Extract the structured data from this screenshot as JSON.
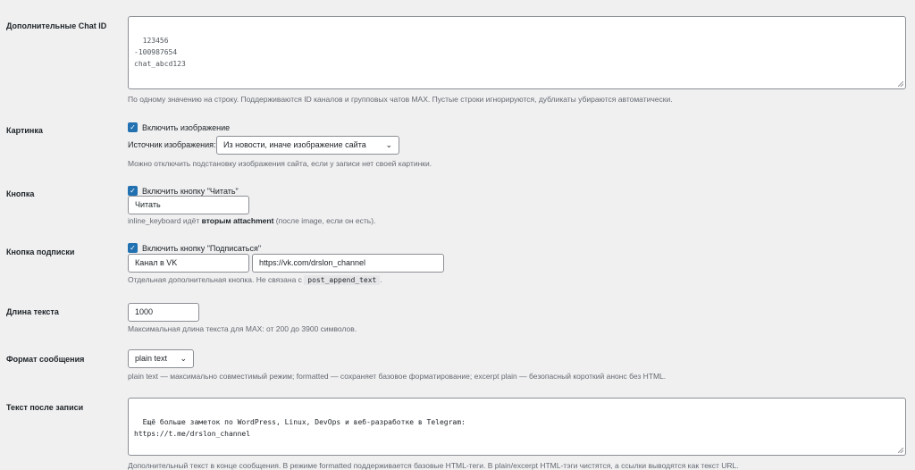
{
  "chat_ids": {
    "label": "Дополнительные Chat ID",
    "value": "123456\n-100987654\nchat_abcd123",
    "desc": "По одному значению на строку. Поддерживаются ID каналов и групповых чатов MAX. Пустые строки игнорируются, дубликаты убираются автоматически."
  },
  "image": {
    "label": "Картинка",
    "checkbox_label": "Включить изображение",
    "source_label": "Источник изображения:",
    "source_value": "Из новости, иначе изображение сайта",
    "desc": "Можно отключить подстановку изображения сайта, если у записи нет своей картинки."
  },
  "button": {
    "label": "Кнопка",
    "checkbox_label": "Включить кнопку \"Читать\"",
    "text_value": "Читать",
    "desc_pre": "inline_keyboard идёт ",
    "desc_bold": "вторым attachment",
    "desc_post": " (после image, если он есть)."
  },
  "subscribe": {
    "label": "Кнопка подписки",
    "checkbox_label": "Включить кнопку \"Подписаться\"",
    "text_value": "Канал в VK",
    "url_value": "https://vk.com/drslon_channel",
    "desc_pre": "Отдельная дополнительная кнопка. Не связана с",
    "desc_code": "post_append_text",
    "desc_post": "."
  },
  "length": {
    "label": "Длина текста",
    "value": "1000",
    "desc": "Максимальная длина текста для MAX: от 200 до 3900 символов."
  },
  "format": {
    "label": "Формат сообщения",
    "value": "plain text",
    "desc": "plain text — максимально совместимый режим; formatted — сохраняет базовое форматирование; excerpt plain — безопасный короткий анонс без HTML."
  },
  "append": {
    "label": "Текст после записи",
    "value": "Ещё больше заметок по WordPress, Linux, DevOps и веб-разработке в Telegram:\nhttps://t.me/drslon_channel",
    "desc": "Дополнительный текст в конце сообщения. В режиме formatted поддерживается базовые HTML-теги. В plain/excerpt HTML-тэги чистятся, а ссылки выводятся как текст URL."
  }
}
